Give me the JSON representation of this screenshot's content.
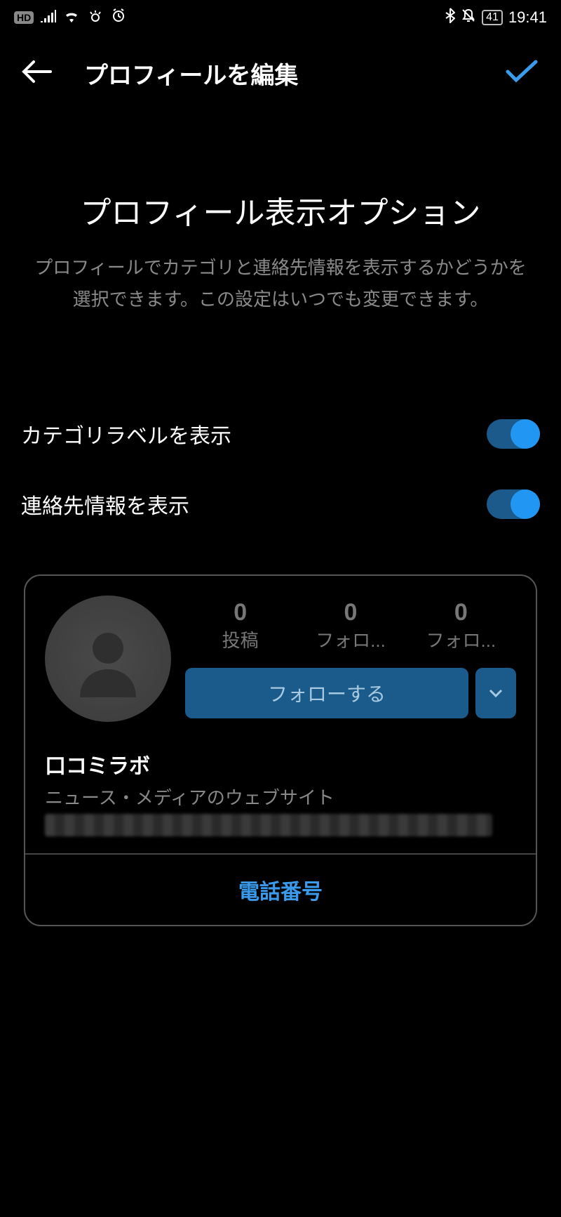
{
  "status": {
    "hd": "HD",
    "battery": "41",
    "time": "19:41"
  },
  "header": {
    "title": "プロフィールを編集"
  },
  "section": {
    "title": "プロフィール表示オプション",
    "description": "プロフィールでカテゴリと連絡先情報を表示するかどうかを選択できます。この設定はいつでも変更できます。"
  },
  "toggles": {
    "category_label": "カテゴリラベルを表示",
    "contact_label": "連絡先情報を表示",
    "category_on": true,
    "contact_on": true
  },
  "preview": {
    "stats": {
      "posts_count": "0",
      "posts_label": "投稿",
      "followers_count": "0",
      "followers_label": "フォロ...",
      "following_count": "0",
      "following_label": "フォロ..."
    },
    "follow_button": "フォローする",
    "account_name": "口コミラボ",
    "category": "ニュース・メディアのウェブサイト",
    "phone_label": "電話番号"
  }
}
